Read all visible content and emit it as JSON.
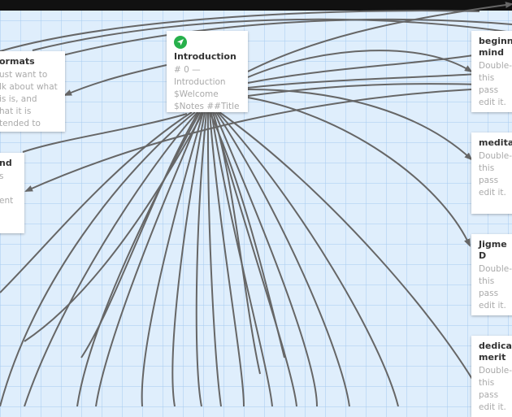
{
  "topbar": {
    "label": ""
  },
  "passages": {
    "formats": {
      "title": "ormats",
      "excerpt": "ust want to\nlk about what\nis is, and\nhat it is\ntended to"
    },
    "second_left": {
      "title": "nd",
      "excerpt": "s\n\nent"
    },
    "introduction": {
      "title": "Introduction",
      "excerpt": "# 0 —\nIntroduction\n$Welcome\n$Notes ##Title",
      "start_icon": "rocket-icon",
      "start_color": "#27b04b"
    },
    "beginners_mind": {
      "title": "beginne\nmind",
      "excerpt": "Double-\nthis pass\nedit it."
    },
    "meditation": {
      "title": "meditat",
      "excerpt": "Double-\nthis pass\nedit it."
    },
    "jigme": {
      "title": "Jigme D",
      "excerpt": "Double-\nthis pass\nedit it."
    },
    "dedication": {
      "title": "dedicat\nmerit",
      "excerpt": "Double-\nthis pass\nedit it."
    }
  },
  "colors": {
    "link": "#666666",
    "grid": "#dfeefc",
    "card": "#ffffff"
  }
}
